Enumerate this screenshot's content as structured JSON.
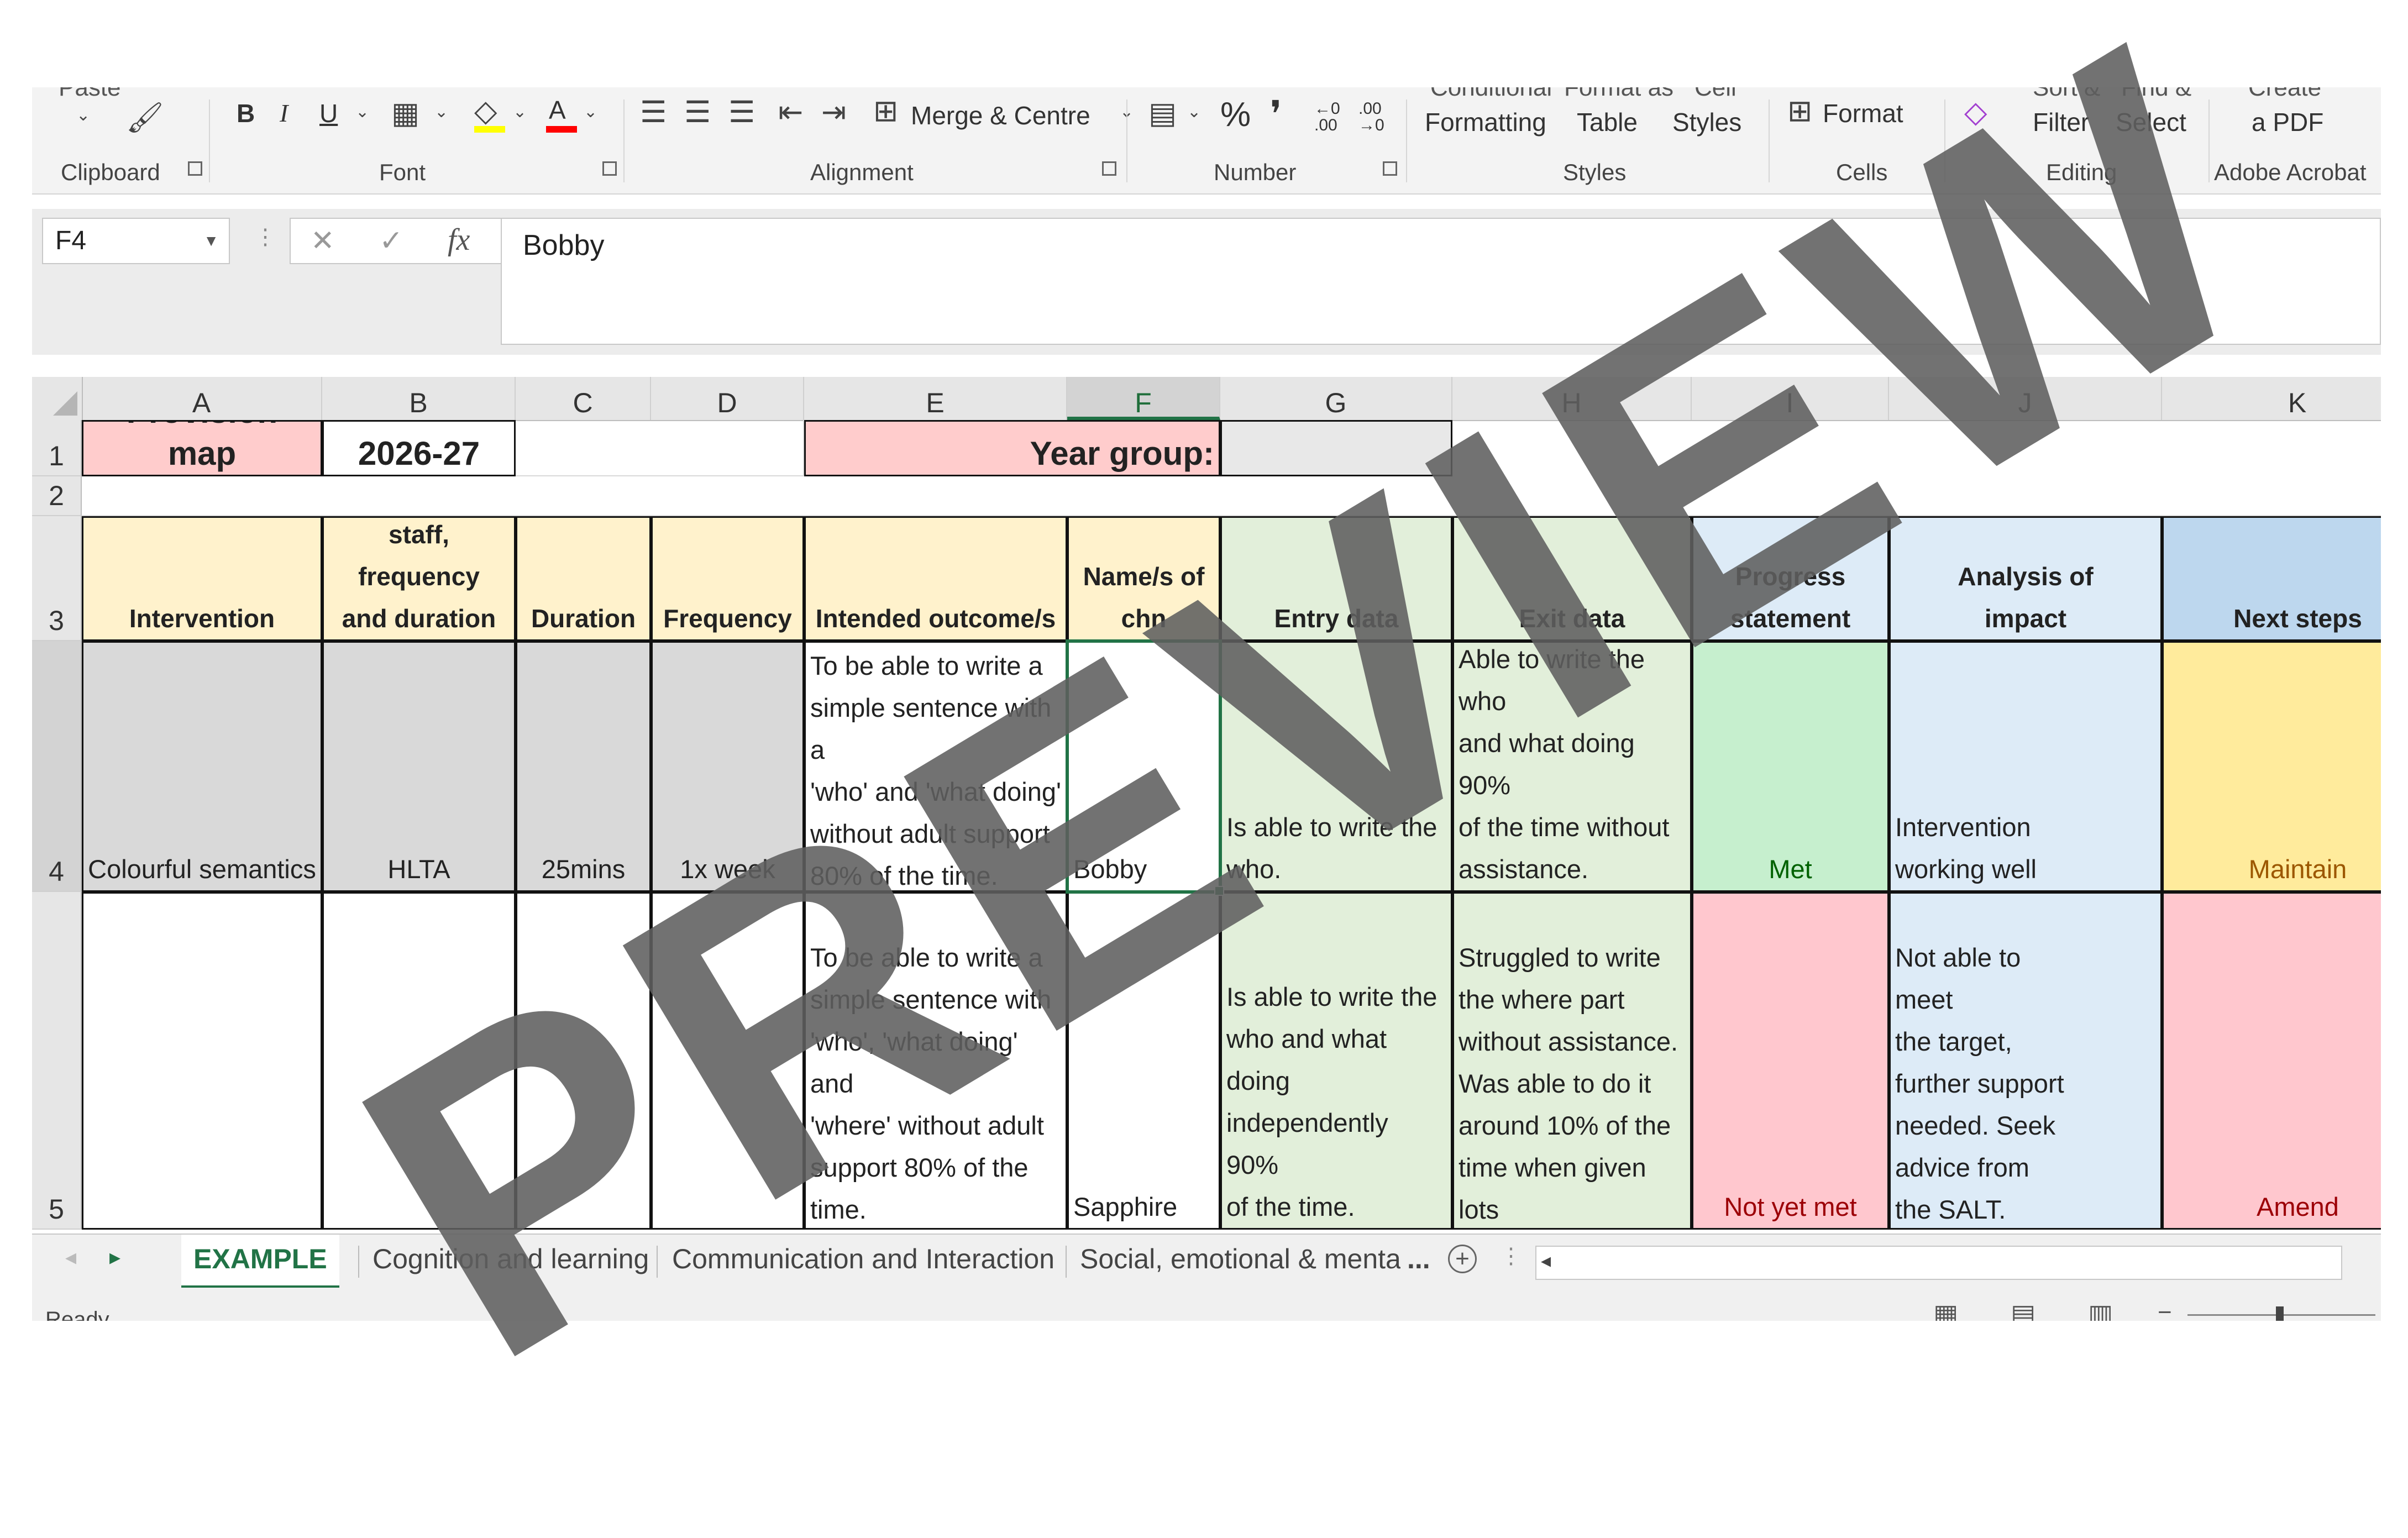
{
  "ribbon": {
    "clipboard": {
      "paste_label": "Paste",
      "group_label": "Clipboard"
    },
    "font": {
      "bold": "B",
      "italic": "I",
      "underline": "U",
      "group_label": "Font",
      "highlight_color": "#ffff00",
      "font_color": "#ff0000"
    },
    "alignment": {
      "merge_label": "Merge & Centre",
      "group_label": "Alignment"
    },
    "number": {
      "percent": "%",
      "comma": "❜",
      "inc_decimal": "←0 .00",
      "dec_decimal": ".00 →0",
      "group_label": "Number"
    },
    "styles": {
      "conditional_top": "Conditional",
      "conditional_bottom": "Formatting",
      "table_top": "Format as",
      "table_bottom": "Table",
      "cellstyles_top": "Cell",
      "cellstyles_bottom": "Styles",
      "group_label": "Styles"
    },
    "cells": {
      "format_label": "Format",
      "group_label": "Cells"
    },
    "editing": {
      "sort_top": "Sort &",
      "sort_bottom": "Filter",
      "find_top": "Find &",
      "find_bottom": "Select",
      "group_label": "Editing"
    },
    "acrobat": {
      "create_top": "Create",
      "create_bottom": "a PDF",
      "group_label": "Adobe Acrobat"
    }
  },
  "formula_bar": {
    "name_box": "F4",
    "fx": "fx",
    "cancel": "✕",
    "enter": "✓",
    "value": "Bobby"
  },
  "columns": [
    "A",
    "B",
    "C",
    "D",
    "E",
    "F",
    "G",
    "H",
    "I",
    "J",
    "K"
  ],
  "rows": [
    "1",
    "2",
    "3",
    "4",
    "5"
  ],
  "sheet": {
    "title": "Provision map",
    "year": "2026-27",
    "year_group_label": "Year group:",
    "year_group_value": "",
    "headers": [
      "Intervention",
      "Member of\nstaff, frequency\nand duration",
      "Duration",
      "Frequency",
      "Intended outcome/s",
      "Name/s of\nchn",
      "Entry data",
      "Exit data",
      "Progress\nstatement",
      "Analysis of\nimpact",
      "Next steps"
    ],
    "row4": [
      "Colourful semantics",
      "HLTA",
      "25mins",
      "1x week",
      "To be able to write a\nsimple sentence with a\n'who' and 'what doing'\nwithout adult support\n80% of the time.",
      "Bobby",
      "Is able to write the\nwho.",
      "Able to write the\nwho\n and what doing 90%\nof the time without\nassistance.",
      "Met",
      "Intervention\nworking well",
      "Maintain"
    ],
    "row5": [
      "",
      "",
      "",
      "",
      "To be able to write a\nsimple sentence with\n'who', 'what doing' and\n'where' without adult\nsupport 80% of the\ntime.",
      "Sapphire",
      "Is able to write the\nwho and what doing\nindependently 90%\nof the time.",
      "Struggled to write\nthe where part\nwithout assistance.\nWas able to do it\naround 10% of the\ntime when given lots\nof visual prompts.",
      "Not yet met",
      "Not able to\nmeet\nthe target,\nfurther support\nneeded. Seek\nadvice from\nthe SALT.",
      "Amend"
    ]
  },
  "tabs": {
    "items": [
      "EXAMPLE",
      "Cognition and learning",
      "Communication and Interaction",
      "Social, emotional & mental"
    ],
    "more": "...",
    "add": "+"
  },
  "status": {
    "ready": "Ready"
  },
  "watermark": "PREVIEW",
  "colors": {
    "header_yellow": "#fff2cc",
    "header_green": "#e2efda",
    "header_blue": "#ddebf7",
    "header_blue_dark": "#bdd7ee",
    "title_pink": "#ffcccc",
    "grey_cells": "#d9d9d9",
    "met_green": "#c6efce",
    "met_text": "#006100",
    "maintain_yellow": "#ffeb9c",
    "maintain_text": "#9c5700",
    "notmet_pink": "#ffc7ce",
    "notmet_text": "#9c0006",
    "excel_green": "#217346"
  }
}
